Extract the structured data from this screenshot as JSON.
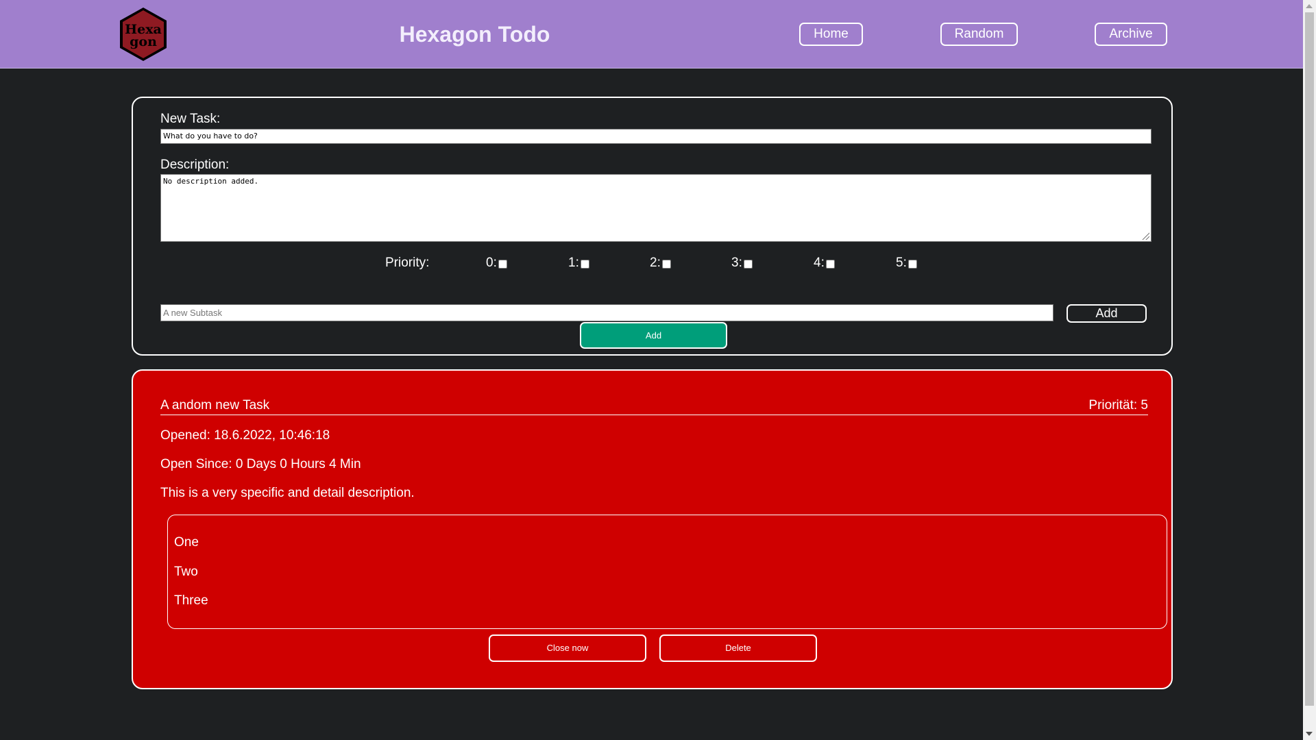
{
  "header": {
    "logo_text": "Hexa gon",
    "title": "Hexagon Todo",
    "nav": [
      "Home",
      "Random",
      "Archive"
    ]
  },
  "form": {
    "task_label": "New Task:",
    "task_value": "What do you have to do?",
    "description_label": "Description:",
    "description_value": "No description added.",
    "priority_label": "Priority:",
    "priority_options": [
      "0:",
      "1:",
      "2:",
      "3:",
      "4:",
      "5:"
    ],
    "subtask_placeholder": "A new Subtask",
    "subtask_add_label": "Add",
    "add_task_label": "Add"
  },
  "task": {
    "title": "A andom new Task",
    "priority": "Priorität: 5",
    "opened": "Opened: 18.6.2022, 10:46:18",
    "open_since": "Open Since: 0 Days 0 Hours 4 Min",
    "description": "This is a very specific and detail description.",
    "subtasks": [
      "One",
      "Two",
      "Three"
    ],
    "close_label": "Close now",
    "delete_label": "Delete",
    "color": "#cf0000"
  },
  "colors": {
    "header_bg": "#a07fcd",
    "page_bg": "#1e2022",
    "add_button": "#009e7a"
  }
}
